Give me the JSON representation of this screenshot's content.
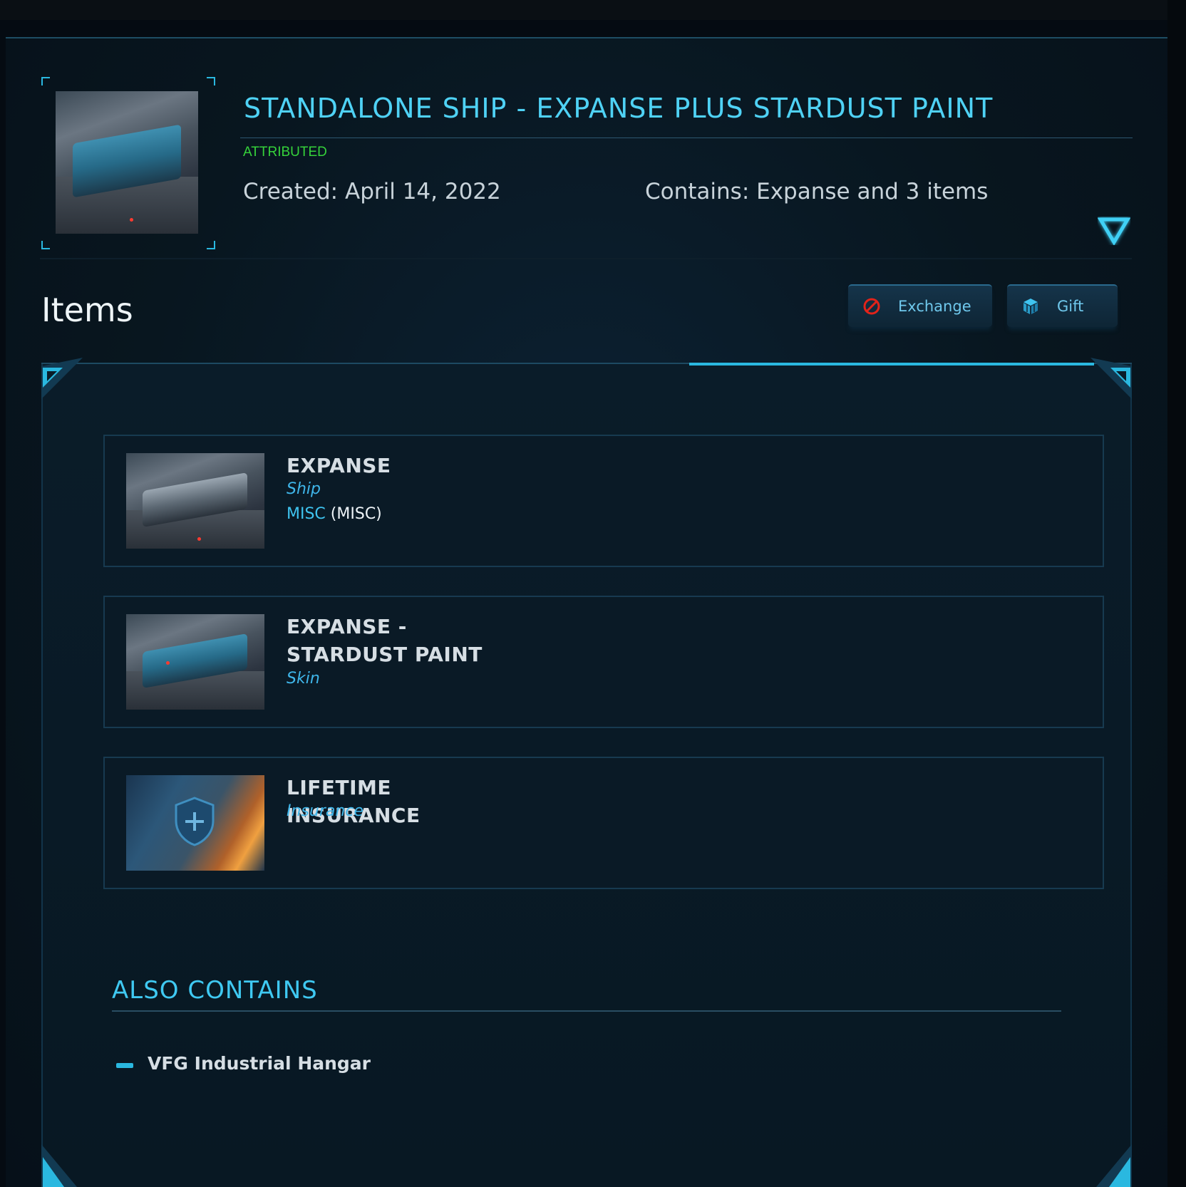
{
  "header": {
    "title": "STANDALONE SHIP - EXPANSE PLUS STARDUST PAINT",
    "status": "ATTRIBUTED",
    "created": "Created: April 14, 2022",
    "contains": "Contains: Expanse and 3 items"
  },
  "section": {
    "title": "Items"
  },
  "actions": {
    "exchange_label": "Exchange",
    "gift_label": "Gift"
  },
  "items": [
    {
      "name": "EXPANSE",
      "type": "Ship",
      "manufacturer": "MISC",
      "manufacturer_code": "(MISC)"
    },
    {
      "name": "EXPANSE - STARDUST PAINT",
      "type": "Skin"
    },
    {
      "name": "LIFETIME INSURANCE",
      "type": "Insurance"
    }
  ],
  "also_contains": {
    "title": "ALSO CONTAINS",
    "items": [
      "VFG Industrial Hangar"
    ]
  },
  "colors": {
    "accent": "#2ab8e0",
    "title": "#4fd2f5",
    "status_green": "#35d23a",
    "item_type": "#3fb6ea"
  },
  "icons": {
    "expand": "triangle-down-icon",
    "exchange": "prohibited-icon",
    "gift": "gift-cube-icon"
  }
}
